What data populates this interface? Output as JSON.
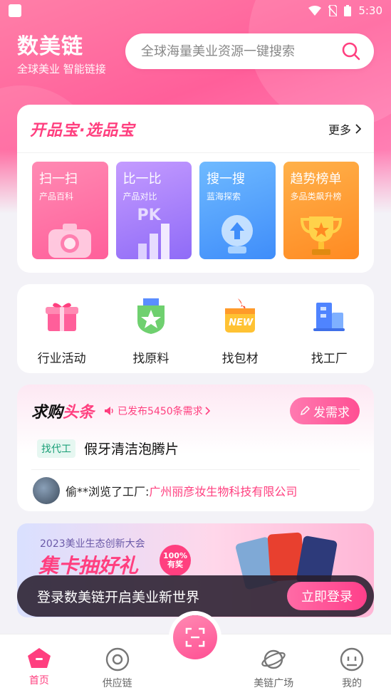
{
  "status": {
    "time": "5:30"
  },
  "brand": {
    "title": "数美链",
    "subtitle": "全球美业 智能链接"
  },
  "search": {
    "placeholder": "全球海量美业资源一键搜索"
  },
  "kpb": {
    "title": "开品宝·选品宝",
    "more_label": "更多",
    "tiles": [
      {
        "title": "扫一扫",
        "subtitle": "产品百科",
        "badge": ""
      },
      {
        "title": "比一比",
        "subtitle": "产品对比",
        "badge": "PK"
      },
      {
        "title": "搜一搜",
        "subtitle": "蓝海探索",
        "badge": ""
      },
      {
        "title": "趋势榜单",
        "subtitle": "多品类飙升榜",
        "badge": ""
      }
    ]
  },
  "categories": [
    {
      "label": "行业活动"
    },
    {
      "label": "找原料"
    },
    {
      "label": "找包材",
      "badge": "NEW"
    },
    {
      "label": "找工厂"
    }
  ],
  "requests": {
    "title_part1": "求购",
    "title_part2": "头条",
    "count_text": "已发布5450条需求",
    "post_button": "发需求",
    "item": {
      "tag": "找代工",
      "text": "假牙清洁泡腾片"
    },
    "browse": {
      "prefix": "偷**浏览了工厂: ",
      "factory": "广州丽彦妆生物科技有限公司"
    }
  },
  "banner": {
    "line1": "2023美业生态创新大会",
    "headline": "集卡抽好礼",
    "badge_line1": "100%",
    "badge_line2": "有奖"
  },
  "login_bar": {
    "text": "登录数美链开启美业新世界",
    "button": "立即登录"
  },
  "tabbar": {
    "items": [
      {
        "label": "首页",
        "active": true
      },
      {
        "label": "供应链",
        "active": false
      },
      {
        "label": "美链广场",
        "active": false
      },
      {
        "label": "我的",
        "active": false
      }
    ]
  },
  "colors": {
    "accent": "#ff3f7f",
    "green_tag": "#1a9f77"
  }
}
